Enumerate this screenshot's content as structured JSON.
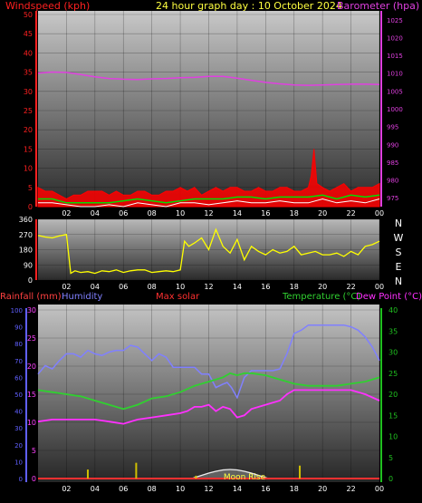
{
  "header": {
    "left": "Windspeed (kph)",
    "center": "24 hour graph day : 10 October 2024",
    "right": "Barometer (hpa)"
  },
  "colors": {
    "wind_axis": "#ff2020",
    "baro_axis": "#e040e0",
    "title": "#ffff40",
    "gust": "#ff0000",
    "avg": "#00e000",
    "wind_low": "#ffffff",
    "direction": "#ffff00",
    "humidity": "#8080ff",
    "rain": "#ff4040",
    "solar": "#ff3030",
    "temperature": "#30d030",
    "dewpoint": "#ff30ff",
    "humidity_axis": "#6060ff",
    "rain_axis": "#ff40ff",
    "temp_axis": "#20c020"
  },
  "bottom_legend": {
    "rainfall": "Rainfall (mm)",
    "humidity": "Humidity",
    "solar": "Max solar",
    "temperature": "Temperature (°C)",
    "dewpoint": "Dew Point (°C)"
  },
  "moon_label": "Moon Rise",
  "compass": [
    "N",
    "W",
    "S",
    "E",
    "N"
  ],
  "chart_data": [
    {
      "type": "line",
      "name": "wind-barometer",
      "x_ticks": [
        "02",
        "04",
        "06",
        "08",
        "10",
        "12",
        "14",
        "16",
        "18",
        "20",
        "22",
        "00"
      ],
      "left_axis": {
        "label": "Windspeed (kph)",
        "ticks": [
          0,
          5,
          10,
          15,
          20,
          25,
          30,
          35,
          40,
          45,
          50
        ],
        "ylim": [
          0,
          50
        ]
      },
      "right_axis": {
        "label": "Barometer (hpa)",
        "ticks": [
          975,
          980,
          985,
          990,
          995,
          1000,
          1005,
          1010,
          1015,
          1020,
          1025
        ],
        "ylim": [
          972.5,
          1027.5
        ]
      },
      "series": [
        {
          "key": "barometer",
          "axis": "right",
          "hours": [
            0,
            1,
            2,
            3,
            4,
            5,
            6,
            7,
            8,
            9,
            10,
            11,
            12,
            13,
            14,
            15,
            16,
            17,
            18,
            19,
            20,
            21,
            22,
            23,
            24
          ],
          "values": [
            1010,
            1010.3,
            1010.2,
            1009.6,
            1009,
            1008.5,
            1008.3,
            1008.2,
            1008.4,
            1008.5,
            1008.7,
            1008.8,
            1009.1,
            1009.1,
            1008.6,
            1008,
            1007.4,
            1007,
            1006.7,
            1006.6,
            1006.7,
            1006.8,
            1006.9,
            1006.9,
            1006.8
          ]
        },
        {
          "key": "gust",
          "axis": "left",
          "hours": [
            0,
            0.5,
            1,
            1.5,
            2,
            2.5,
            3,
            3.5,
            4,
            4.5,
            5,
            5.5,
            6,
            6.5,
            7,
            7.5,
            8,
            8.5,
            9,
            9.5,
            10,
            10.5,
            11,
            11.5,
            12,
            12.5,
            13,
            13.5,
            14,
            14.5,
            15,
            15.5,
            16,
            16.5,
            17,
            17.5,
            18,
            18.5,
            19,
            19.2,
            19.4,
            19.6,
            20,
            20.5,
            21,
            21.5,
            22,
            22.5,
            23,
            23.5,
            24
          ],
          "values": [
            5,
            4,
            4,
            3,
            2,
            3,
            3,
            4,
            4,
            4,
            3,
            4,
            3,
            3,
            4,
            4,
            3,
            3,
            4,
            4,
            5,
            4,
            5,
            3,
            4,
            5,
            4,
            5,
            5,
            4,
            4,
            5,
            4,
            4,
            5,
            5,
            4,
            4,
            5,
            8,
            15,
            6,
            5,
            4,
            5,
            6,
            4,
            5,
            5,
            5,
            6
          ]
        },
        {
          "key": "average",
          "axis": "left",
          "hours": [
            0,
            1,
            2,
            3,
            4,
            5,
            6,
            7,
            8,
            9,
            10,
            11,
            12,
            13,
            14,
            15,
            16,
            17,
            18,
            19,
            20,
            21,
            22,
            23,
            24
          ],
          "values": [
            2,
            2,
            1,
            1,
            1,
            1,
            1.5,
            2,
            1.5,
            1,
            1.5,
            2,
            2,
            2,
            2.5,
            2.5,
            2,
            2.5,
            2.5,
            2.5,
            3,
            2,
            3,
            2.5,
            3
          ]
        },
        {
          "key": "windspeed",
          "axis": "left",
          "hours": [
            0,
            1,
            2,
            3,
            4,
            5,
            6,
            7,
            8,
            9,
            10,
            11,
            12,
            13,
            14,
            15,
            16,
            17,
            18,
            19,
            20,
            21,
            22,
            23,
            24
          ],
          "values": [
            1,
            1,
            0.5,
            0,
            0,
            0.5,
            0,
            1,
            0.5,
            0,
            1,
            1,
            0.5,
            1,
            1.5,
            1,
            1,
            1.5,
            1,
            1,
            2,
            1,
            1.5,
            1,
            2
          ]
        }
      ]
    },
    {
      "type": "line",
      "name": "wind-direction",
      "x_ticks": [
        "02",
        "04",
        "06",
        "08",
        "10",
        "12",
        "14",
        "16",
        "18",
        "20",
        "22",
        "00"
      ],
      "left_axis": {
        "ticks": [
          0,
          90,
          180,
          270,
          360
        ],
        "ylim": [
          0,
          360
        ]
      },
      "series": [
        {
          "key": "direction",
          "hours": [
            0,
            0.5,
            1,
            1.5,
            2,
            2.3,
            2.6,
            3,
            3.5,
            4,
            4.5,
            5,
            5.5,
            6,
            6.5,
            7,
            7.5,
            8,
            8.5,
            9,
            9.5,
            10,
            10.3,
            10.6,
            11,
            11.5,
            12,
            12.5,
            13,
            13.5,
            14,
            14.5,
            15,
            15.5,
            16,
            16.5,
            17,
            17.5,
            18,
            18.5,
            19,
            19.5,
            20,
            20.5,
            21,
            21.5,
            22,
            22.5,
            23,
            23.5,
            24
          ],
          "values": [
            265,
            255,
            250,
            262,
            270,
            40,
            55,
            45,
            50,
            40,
            55,
            50,
            60,
            45,
            55,
            60,
            60,
            45,
            50,
            55,
            50,
            60,
            230,
            200,
            220,
            250,
            180,
            300,
            200,
            160,
            240,
            120,
            200,
            170,
            150,
            180,
            160,
            170,
            200,
            150,
            160,
            170,
            150,
            150,
            160,
            140,
            170,
            150,
            200,
            210,
            230
          ]
        }
      ]
    },
    {
      "type": "line",
      "name": "rain-humidity-temperature",
      "x_ticks": [
        "02",
        "04",
        "06",
        "08",
        "10",
        "12",
        "14",
        "16",
        "18",
        "20",
        "22",
        "00"
      ],
      "humidity_axis": {
        "ticks": [
          0,
          10,
          20,
          30,
          40,
          50,
          60,
          70,
          80,
          90,
          100
        ],
        "ylim": [
          0,
          100
        ]
      },
      "rain_axis": {
        "ticks": [
          0,
          5,
          10,
          15,
          20,
          25,
          30
        ],
        "ylim": [
          0,
          30
        ]
      },
      "temp_axis": {
        "ticks": [
          0,
          5,
          10,
          15,
          20,
          25,
          30,
          35,
          40
        ],
        "ylim": [
          0,
          40
        ]
      },
      "series": [
        {
          "key": "humidity",
          "hours": [
            0,
            0.5,
            1,
            1.5,
            2,
            2.5,
            3,
            3.5,
            4,
            4.5,
            5,
            5.5,
            6,
            6.5,
            7,
            7.5,
            8,
            8.5,
            9,
            9.5,
            10,
            10.5,
            11,
            11.5,
            12,
            12.5,
            13,
            13.3,
            13.6,
            14,
            14.5,
            15,
            15.5,
            16,
            16.5,
            17,
            17.5,
            18,
            18.5,
            19,
            19.5,
            20,
            20.5,
            21,
            21.5,
            22,
            22.5,
            23,
            23.5,
            24
          ],
          "values": [
            62,
            67,
            65,
            70,
            74,
            74,
            72,
            76,
            74,
            73,
            75,
            76,
            76,
            79,
            78,
            74,
            70,
            74,
            72,
            66,
            66,
            66,
            66,
            62,
            62,
            54,
            56,
            57,
            54,
            48,
            60,
            64,
            64,
            64,
            64,
            65,
            74,
            86,
            88,
            91,
            91,
            91,
            91,
            91,
            91,
            90,
            88,
            84,
            78,
            70
          ]
        },
        {
          "key": "temperature",
          "hours": [
            0,
            1,
            2,
            3,
            4,
            5,
            6,
            7,
            8,
            9,
            10,
            11,
            12,
            13,
            13.5,
            14,
            14.5,
            15,
            16,
            17,
            18,
            19,
            20,
            21,
            22,
            23,
            24
          ],
          "values": [
            21,
            20.5,
            20,
            19.5,
            18.5,
            17.5,
            16.5,
            17.5,
            19,
            19.5,
            20.5,
            22,
            23,
            24,
            25,
            24.5,
            25,
            25,
            24.5,
            23.5,
            22.5,
            22,
            22,
            22,
            22.5,
            23,
            24
          ]
        },
        {
          "key": "dewpoint",
          "hours": [
            0,
            1,
            2,
            3,
            4,
            5,
            6,
            7,
            8,
            9,
            10,
            10.5,
            11,
            11.5,
            12,
            12.5,
            13,
            13.5,
            14,
            14.5,
            15,
            16,
            17,
            17.5,
            18,
            19,
            20,
            21,
            22,
            23,
            24
          ],
          "values": [
            13.5,
            14,
            14,
            14,
            14,
            13.5,
            13,
            14,
            14.5,
            15,
            15.5,
            16,
            17,
            17,
            17.5,
            16,
            17,
            16.5,
            14.5,
            15,
            16.5,
            17.5,
            18.5,
            20,
            21,
            21,
            21,
            21,
            21,
            20,
            18.5
          ]
        },
        {
          "key": "solar",
          "hours": [
            0,
            10.8,
            11,
            11.5,
            12,
            12.5,
            13,
            13.5,
            14,
            14.5,
            15,
            15.5,
            16,
            16.2,
            24
          ],
          "values": [
            0,
            0,
            0.1,
            0.35,
            0.6,
            0.8,
            0.95,
            1,
            0.95,
            0.8,
            0.6,
            0.35,
            0.1,
            0,
            0
          ]
        }
      ],
      "rain_bars": {
        "hours": [
          3.5,
          6.9,
          11.1,
          18.4
        ],
        "values": [
          1.6,
          2.8,
          0.5,
          2.3
        ]
      }
    }
  ]
}
